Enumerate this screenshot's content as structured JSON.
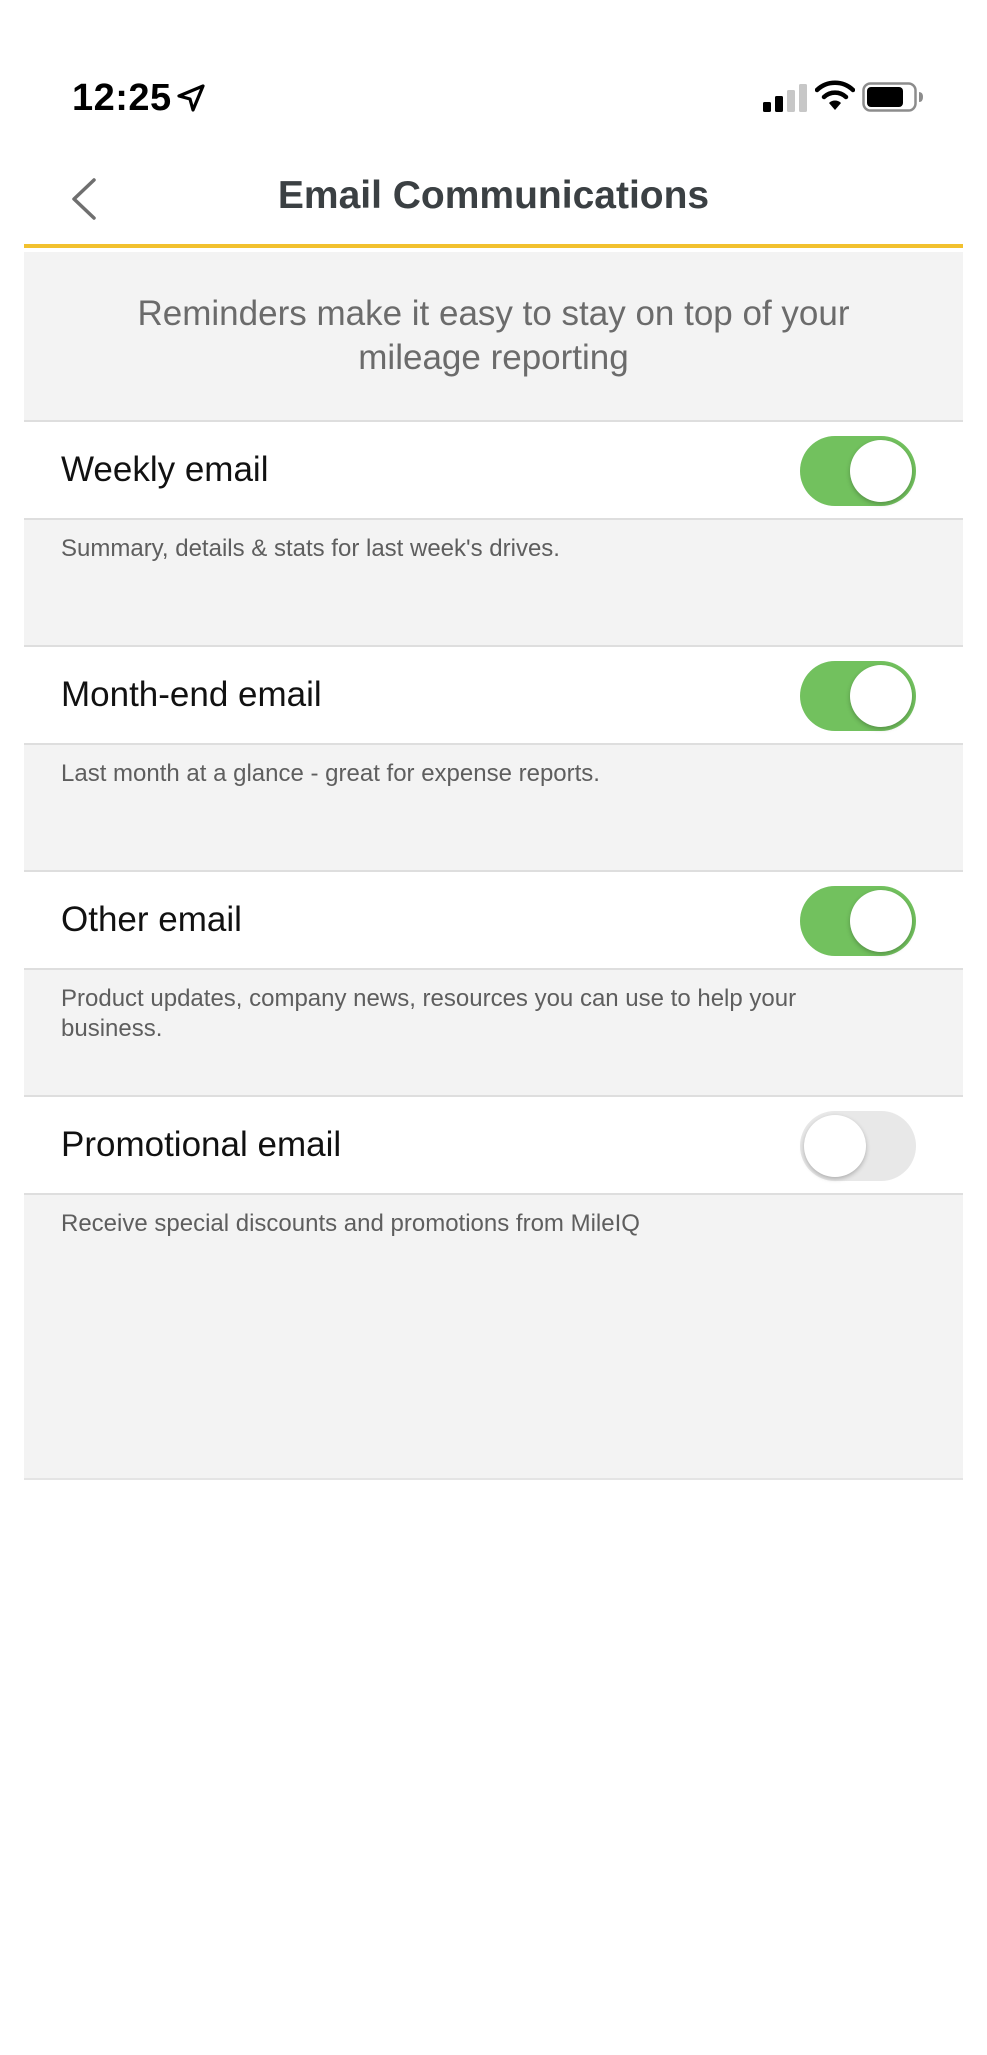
{
  "status_bar": {
    "time": "12:25"
  },
  "header": {
    "title": "Email Communications"
  },
  "intro": {
    "text": "Reminders make it easy to stay on top of your mileage reporting"
  },
  "settings": [
    {
      "label": "Weekly email",
      "description": "Summary, details & stats for last week's drives.",
      "enabled": true
    },
    {
      "label": "Month-end email",
      "description": "Last month at a glance - great for expense reports.",
      "enabled": true
    },
    {
      "label": "Other email",
      "description": "Product updates, company news, resources you can use to help your business.",
      "enabled": true
    },
    {
      "label": "Promotional email",
      "description": "Receive special discounts and promotions from MileIQ",
      "enabled": false
    }
  ],
  "colors": {
    "accent_border": "#f2c12e",
    "toggle_on": "#72c15e",
    "toggle_off": "#e8e8e8"
  }
}
